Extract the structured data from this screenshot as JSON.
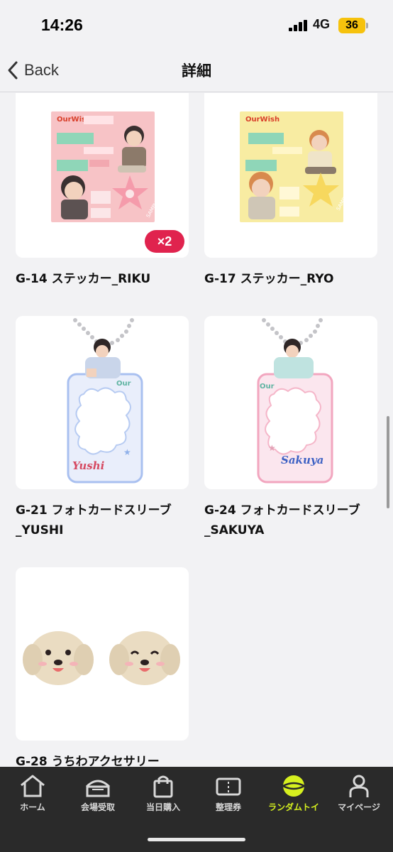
{
  "status_bar": {
    "time": "14:26",
    "network": "4G",
    "battery": "36"
  },
  "nav": {
    "back_label": "Back",
    "title": "詳細"
  },
  "items": [
    {
      "name": "G-14 ステッカー_RIKU",
      "quantity_badge": "×2",
      "image": "riku-sticker-sheet"
    },
    {
      "name": "G-17 ステッカー_RYO",
      "image": "ryo-sticker-sheet"
    },
    {
      "name": "G-21 フォトカードスリーブ_YUSHI",
      "image": "yushi-photocard-sleeve"
    },
    {
      "name": "G-24 フォトカードスリーブ_SAKUYA",
      "image": "sakuya-photocard-sleeve"
    },
    {
      "name": "G-28 うちわアクセサリー",
      "image": "uchiwa-accessory-dogs"
    }
  ],
  "tabs": [
    {
      "label": "ホーム",
      "icon": "home-icon"
    },
    {
      "label": "会場受取",
      "icon": "venue-pickup-icon"
    },
    {
      "label": "当日購入",
      "icon": "shopping-bag-icon"
    },
    {
      "label": "整理券",
      "icon": "ticket-icon"
    },
    {
      "label": "ランダムトイ",
      "icon": "random-toy-icon",
      "active": true
    },
    {
      "label": "マイページ",
      "icon": "person-icon"
    }
  ],
  "colors": {
    "accent": "#d6f01f",
    "badge": "#e0234e",
    "tab_bar": "#2a2a2a"
  }
}
